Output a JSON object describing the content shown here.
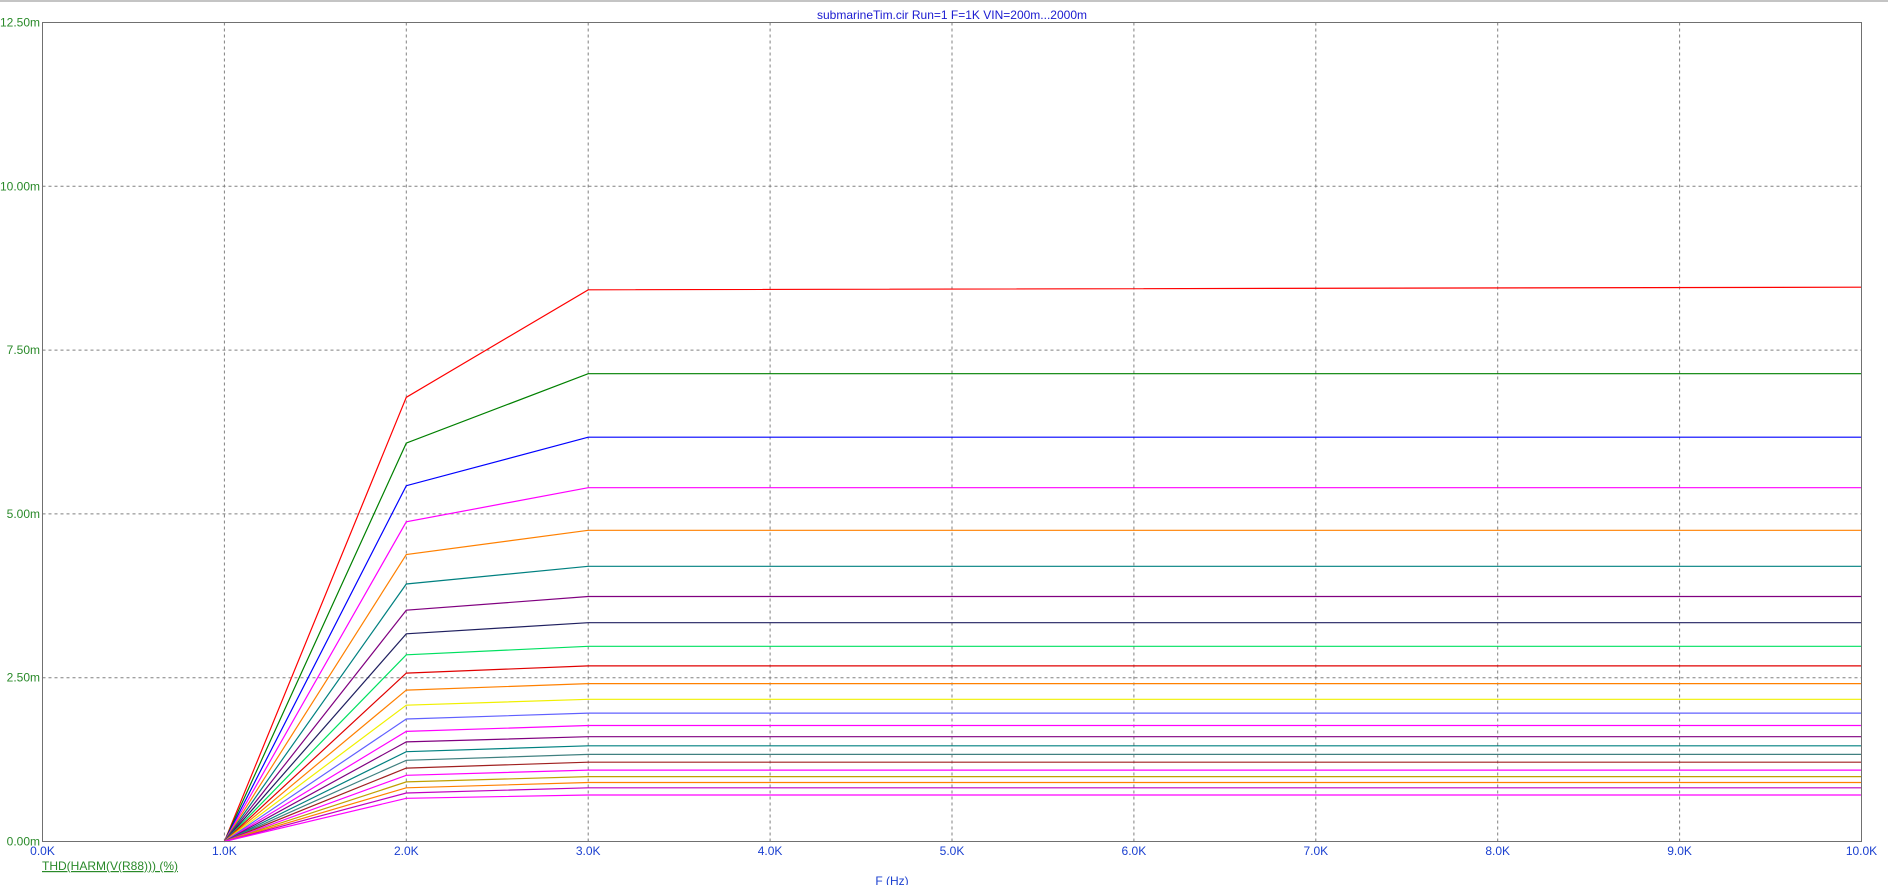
{
  "chart_data": {
    "type": "line",
    "title": "submarineTim.cir Run=1 F=1K VIN=200m...2000m",
    "xlabel": "F (Hz)",
    "ylabel": "THD(HARM(V(R88))) (%)",
    "x_tick_labels": [
      "0.0K",
      "1.0K",
      "2.0K",
      "3.0K",
      "4.0K",
      "5.0K",
      "6.0K",
      "7.0K",
      "8.0K",
      "9.0K",
      "10.0K"
    ],
    "y_tick_labels": [
      "0.00m",
      "2.50m",
      "5.00m",
      "7.50m",
      "10.00m",
      "12.50m"
    ],
    "xlim": [
      0,
      10000
    ],
    "ylim": [
      0,
      0.0125
    ],
    "grid": true,
    "x": [
      1000,
      2000,
      3000,
      10000
    ],
    "series": [
      {
        "color": "#ff0000",
        "values": [
          0,
          0.00678,
          0.00842,
          0.00846
        ]
      },
      {
        "color": "#008000",
        "values": [
          0,
          0.00608,
          0.00714,
          0.00714
        ]
      },
      {
        "color": "#0000ff",
        "values": [
          0,
          0.00543,
          0.00617,
          0.00617
        ]
      },
      {
        "color": "#ff00ff",
        "values": [
          0,
          0.00488,
          0.0054,
          0.0054
        ]
      },
      {
        "color": "#ff8000",
        "values": [
          0,
          0.00438,
          0.00475,
          0.00475
        ]
      },
      {
        "color": "#008080",
        "values": [
          0,
          0.00393,
          0.0042,
          0.0042
        ]
      },
      {
        "color": "#800080",
        "values": [
          0,
          0.00353,
          0.00374,
          0.00374
        ]
      },
      {
        "color": "#202060",
        "values": [
          0,
          0.00317,
          0.00334,
          0.00334
        ]
      },
      {
        "color": "#00e060",
        "values": [
          0,
          0.00285,
          0.00298,
          0.00298
        ]
      },
      {
        "color": "#e00000",
        "values": [
          0,
          0.00257,
          0.00268,
          0.00268
        ]
      },
      {
        "color": "#ff8000",
        "values": [
          0,
          0.00231,
          0.00241,
          0.00241
        ]
      },
      {
        "color": "#f0f000",
        "values": [
          0,
          0.00208,
          0.00217,
          0.00217
        ]
      },
      {
        "color": "#6060ff",
        "values": [
          0,
          0.00187,
          0.00196,
          0.00196
        ]
      },
      {
        "color": "#ff00ff",
        "values": [
          0,
          0.00168,
          0.00177,
          0.00177
        ]
      },
      {
        "color": "#800080",
        "values": [
          0,
          0.00152,
          0.0016,
          0.0016
        ]
      },
      {
        "color": "#008080",
        "values": [
          0,
          0.00137,
          0.00146,
          0.00146
        ]
      },
      {
        "color": "#408080",
        "values": [
          0,
          0.00124,
          0.00133,
          0.00133
        ]
      },
      {
        "color": "#a02020",
        "values": [
          0,
          0.00112,
          0.00121,
          0.00121
        ]
      },
      {
        "color": "#ff00ff",
        "values": [
          0,
          0.00101,
          0.00109,
          0.00109
        ]
      },
      {
        "color": "#c0a000",
        "values": [
          0,
          0.00091,
          0.00099,
          0.00099
        ]
      },
      {
        "color": "#ff8000",
        "values": [
          0,
          0.00082,
          0.0009,
          0.0009
        ]
      },
      {
        "color": "#c000c0",
        "values": [
          0,
          0.00074,
          0.00082,
          0.00082
        ]
      },
      {
        "color": "#ff00ff",
        "values": [
          0,
          0.00066,
          0.00071,
          0.00071
        ]
      }
    ]
  }
}
